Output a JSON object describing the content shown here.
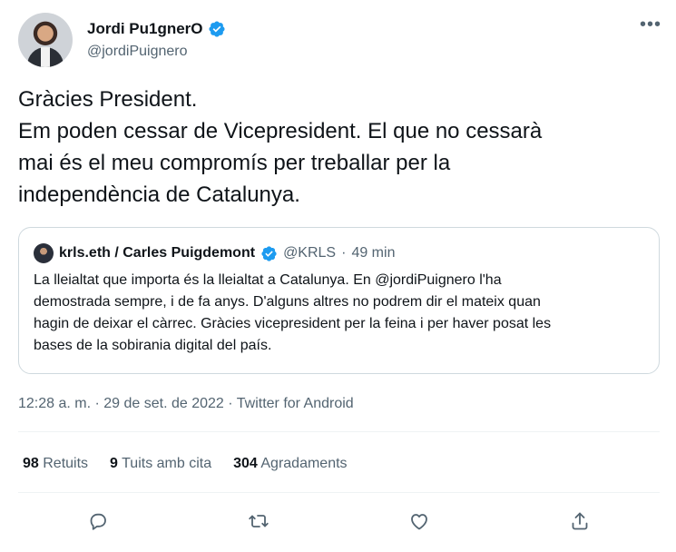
{
  "author": {
    "name": "Jordi Pu1gnerO",
    "handle": "@jordiPuignero",
    "verified": true
  },
  "tweet": {
    "lines": [
      "Gràcies President.",
      "Em poden cessar de Vicepresident. El que no cessarà",
      "mai és el meu compromís per treballar per la",
      "independència de Catalunya."
    ]
  },
  "quoted": {
    "name": "krls.eth / Carles Puigdemont",
    "handle": "@KRLS",
    "separator": "·",
    "time": "49 min",
    "lines": [
      "La lleialtat que importa és la lleialtat a Catalunya. En @jordiPuignero l'ha",
      "demostrada sempre, i de fa anys. D'alguns altres no podrem dir el mateix quan",
      "hagin de deixar el càrrec. Gràcies vicepresident per la feina i per haver posat les",
      "bases de la sobirania digital del país."
    ]
  },
  "timestamp": "12:28 a. m. · 29 de set. de 2022 · Twitter for Android",
  "stats": {
    "retweets_count": "98",
    "retweets_label": "Retuits",
    "quotes_count": "9",
    "quotes_label": "Tuits amb cita",
    "likes_count": "304",
    "likes_label": "Agradaments"
  },
  "actions": [
    "reply-icon",
    "retweet-icon",
    "like-icon",
    "share-icon"
  ],
  "colors": {
    "text": "#0f1419",
    "secondary": "#536471",
    "verified": "#1d9bf0",
    "border": "#cfd9de"
  }
}
